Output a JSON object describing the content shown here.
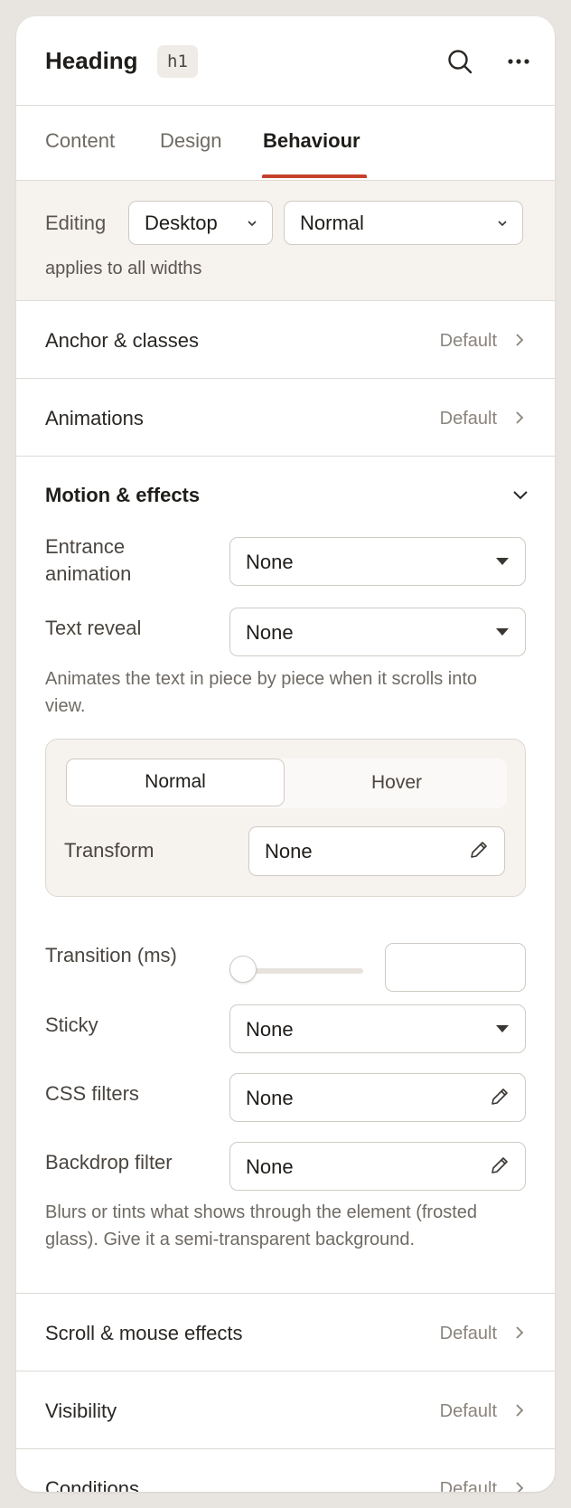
{
  "header": {
    "title": "Heading",
    "tag_badge": "h1",
    "search_icon": "search-icon",
    "more_icon": "more-horizontal-icon"
  },
  "tabs": [
    {
      "label": "Content"
    },
    {
      "label": "Design"
    },
    {
      "label": "Behaviour",
      "active": true
    }
  ],
  "editing": {
    "label": "Editing",
    "device": "Desktop",
    "state": "Normal",
    "note": "applies to all widths"
  },
  "sections_top": [
    {
      "title": "Anchor & classes",
      "value": "Default"
    },
    {
      "title": "Animations",
      "value": "Default"
    }
  ],
  "motion": {
    "title": "Motion & effects",
    "entrance_label": "Entrance animation",
    "entrance_value": "None",
    "text_reveal_label": "Text reveal",
    "text_reveal_value": "None",
    "text_reveal_help": "Animates the text in piece by piece when it scrolls into view.",
    "state_normal": "Normal",
    "state_hover": "Hover",
    "transform_label": "Transform",
    "transform_value": "None",
    "transition_label": "Transition (ms)",
    "transition_value": "",
    "transition_level": 0,
    "sticky_label": "Sticky",
    "sticky_value": "None",
    "css_filters_label": "CSS filters",
    "css_filters_value": "None",
    "backdrop_label": "Backdrop filter",
    "backdrop_value": "None",
    "backdrop_help": "Blurs or tints what shows through the element (frosted glass). Give it a semi-transparent background."
  },
  "sections_bottom": [
    {
      "title": "Scroll & mouse effects",
      "value": "Default"
    },
    {
      "title": "Visibility",
      "value": "Default"
    },
    {
      "title": "Conditions",
      "value": "Default"
    }
  ],
  "colors": {
    "accent": "#c6412b",
    "panel": "#ffffff",
    "tint": "#f6f2ee",
    "border": "#dedad5"
  }
}
